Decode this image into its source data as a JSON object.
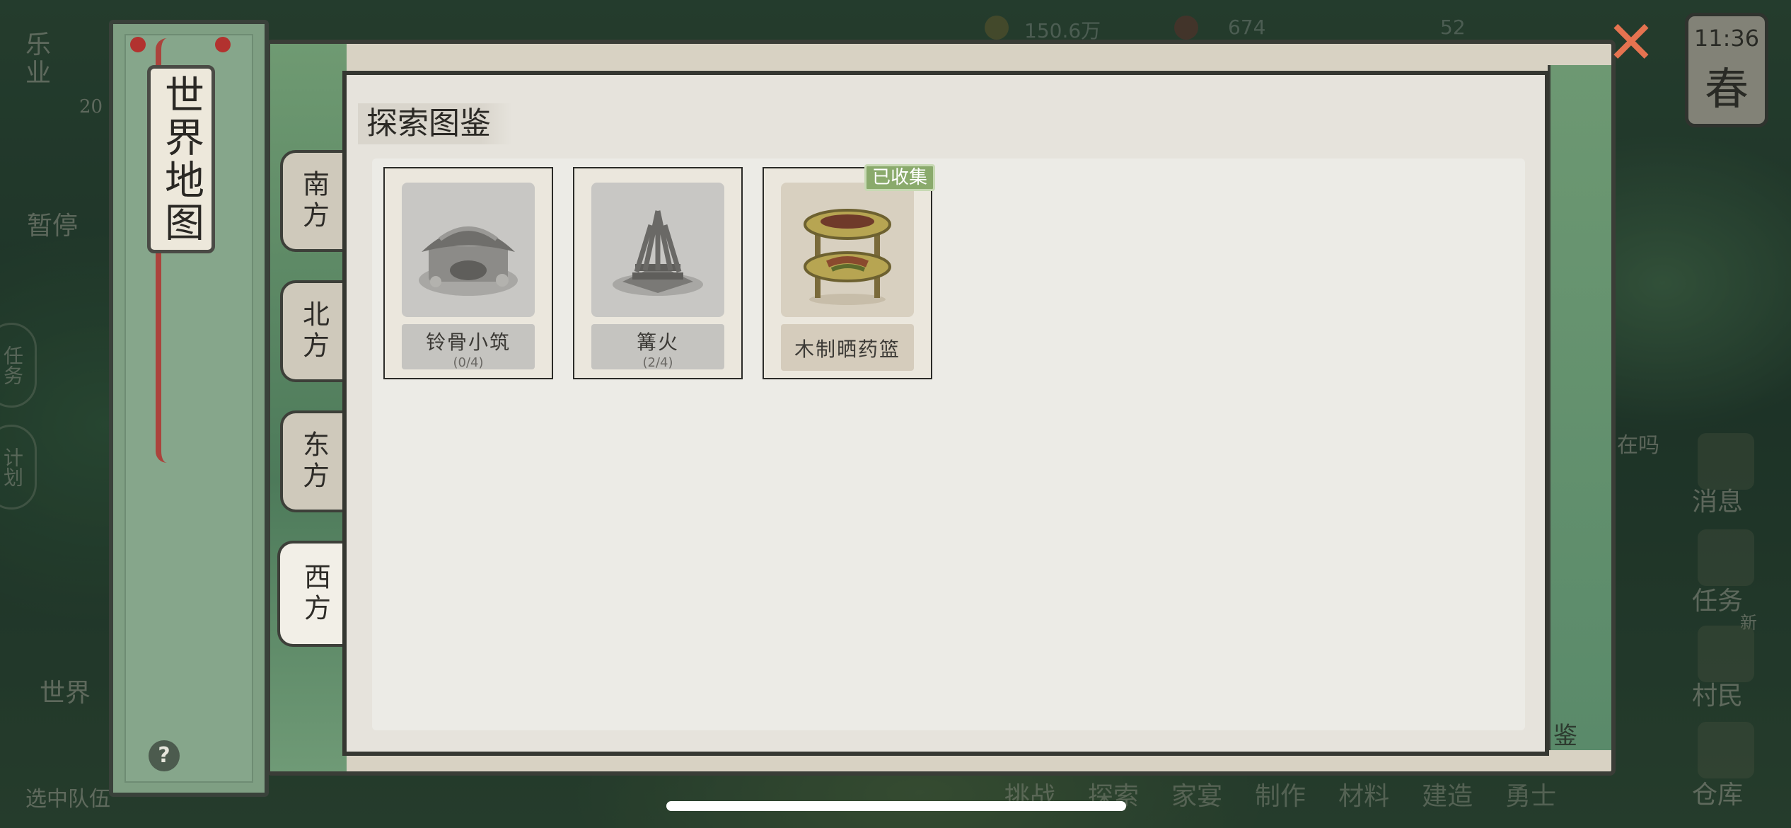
{
  "hud": {
    "left_top_label": "乐业",
    "left_top_value": "20",
    "pause_label": "暂停",
    "task_label": "任务",
    "plan_label": "计划",
    "world_label": "世界",
    "team_label": "选中队伍",
    "copper": "150.6万",
    "res2": "674",
    "res3": "52",
    "time": "11:36",
    "season": "春"
  },
  "right_menu": {
    "chat_hint": "在吗",
    "messages": "消息",
    "tasks": "任务",
    "new_badge": "新",
    "villagers": "村民",
    "warehouse": "仓库",
    "catalog": "鉴"
  },
  "bottom_menu": [
    "挑战",
    "探索",
    "家宴",
    "制作",
    "材料",
    "建造",
    "勇士"
  ],
  "book": {
    "title": "世界地图",
    "help": "?",
    "tabs": [
      {
        "label": "南方",
        "active": false
      },
      {
        "label": "北方",
        "active": false
      },
      {
        "label": "东方",
        "active": false
      },
      {
        "label": "西方",
        "active": true
      }
    ],
    "header": "探索图鉴",
    "cards": [
      {
        "name": "铃骨小筑",
        "count": "(0/4)",
        "collected": false,
        "icon": "hut-icon"
      },
      {
        "name": "篝火",
        "count": "(2/4)",
        "collected": false,
        "icon": "bonfire-icon"
      },
      {
        "name": "木制晒药篮",
        "count": "",
        "collected": true,
        "badge": "已收集",
        "icon": "herb-rack-icon"
      }
    ]
  },
  "colors": {
    "accent_close": "#e57350",
    "collected_badge": "#8aaa6c",
    "book_green": "#7f9f83"
  }
}
